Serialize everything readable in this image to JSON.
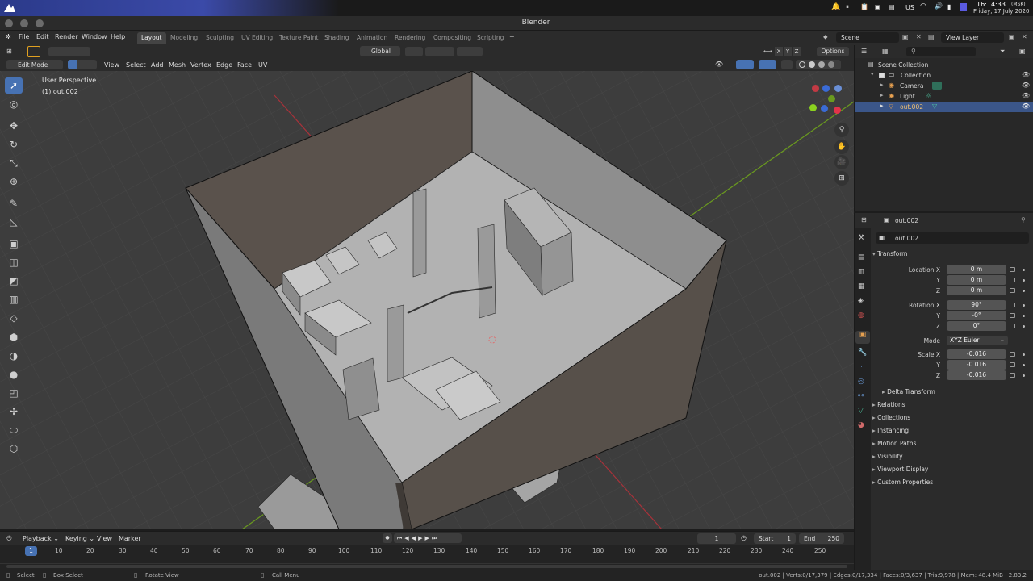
{
  "system": {
    "time": "16:14:33",
    "tz": "(MSK)",
    "date": "Friday, 17 July 2020",
    "lang": "US"
  },
  "window": {
    "title": "Blender"
  },
  "menu": {
    "items": [
      "File",
      "Edit",
      "Render",
      "Window",
      "Help"
    ]
  },
  "workspaces": [
    "Layout",
    "Modeling",
    "Sculpting",
    "UV Editing",
    "Texture Paint",
    "Shading",
    "Animation",
    "Rendering",
    "Compositing",
    "Scripting"
  ],
  "scene": {
    "name": "Scene",
    "view_layer": "View Layer"
  },
  "viewport_header": {
    "mode": "Edit Mode",
    "menus": [
      "View",
      "Select",
      "Add",
      "Mesh",
      "Vertex",
      "Edge",
      "Face",
      "UV"
    ],
    "orientation": "Global",
    "options": "Options",
    "axes": [
      "X",
      "Y",
      "Z"
    ]
  },
  "viewport": {
    "perspective": "User Perspective",
    "object_info": "(1) out.002"
  },
  "outliner": {
    "root": "Scene Collection",
    "items": [
      {
        "label": "Collection"
      },
      {
        "label": "Camera"
      },
      {
        "label": "Light"
      },
      {
        "label": "out.002"
      }
    ]
  },
  "properties": {
    "object_name": "out.002",
    "object_field": "out.002",
    "transform_title": "Transform",
    "location_label": "Location X",
    "location": [
      "0 m",
      "0 m",
      "0 m"
    ],
    "rotation_label": "Rotation X",
    "rotation": [
      "90°",
      "-0°",
      "0°"
    ],
    "mode_label": "Mode",
    "mode": "XYZ Euler",
    "scale_label": "Scale X",
    "scale": [
      "-0.016",
      "-0.016",
      "-0.016"
    ],
    "y": "Y",
    "z": "Z",
    "delta": "Delta Transform",
    "sections": [
      "Relations",
      "Collections",
      "Instancing",
      "Motion Paths",
      "Visibility",
      "Viewport Display",
      "Custom Properties"
    ]
  },
  "timeline": {
    "menus": [
      "Playback",
      "Keying",
      "View",
      "Marker"
    ],
    "current_frame": "1",
    "start_label": "Start",
    "start": "1",
    "end_label": "End",
    "end": "250",
    "ticks": [
      "10",
      "20",
      "30",
      "40",
      "50",
      "60",
      "70",
      "80",
      "90",
      "100",
      "110",
      "120",
      "130",
      "140",
      "150",
      "160",
      "170",
      "180",
      "190",
      "200",
      "210",
      "220",
      "230",
      "240",
      "250"
    ],
    "playhead": "1"
  },
  "status": {
    "select": "Select",
    "box_select": "Box Select",
    "rotate_view": "Rotate View",
    "call_menu": "Call Menu",
    "stats": "out.002 | Verts:0/17,379 | Edges:0/17,334 | Faces:0/3,637 | Tris:9,978 | Mem: 48.4 MiB | 2.83.2"
  },
  "colors": {
    "accent": "#4772b3",
    "viewport_bg": "#3d3d3d",
    "x_axis": "#c0303a",
    "y_axis": "#6a9a1f"
  }
}
